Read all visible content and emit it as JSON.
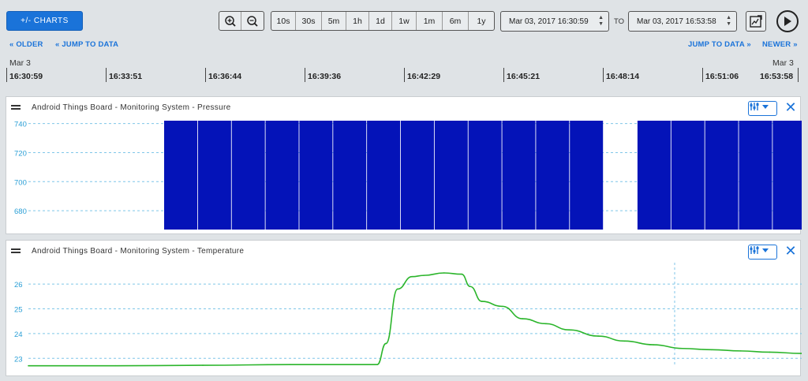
{
  "toolbar": {
    "charts_label": "+/- CHARTS",
    "zoom_ranges": [
      "10s",
      "30s",
      "5m",
      "1h",
      "1d",
      "1w",
      "1m",
      "6m",
      "1y"
    ],
    "from": "Mar 03, 2017 16:30:59",
    "to_label": "TO",
    "to": "Mar 03, 2017 16:53:58"
  },
  "nav": {
    "older": "« OLDER",
    "jump_left": "« JUMP TO DATA",
    "jump_right": "JUMP TO DATA »",
    "newer": "NEWER »"
  },
  "time_axis": {
    "start_date": "Mar 3",
    "end_date": "Mar 3",
    "ticks": [
      "16:30:59",
      "16:33:51",
      "16:36:44",
      "16:39:36",
      "16:42:29",
      "16:45:21",
      "16:48:14",
      "16:51:06",
      "16:53:58"
    ]
  },
  "panels": [
    {
      "title": "Android Things Board - Monitoring System - Pressure"
    },
    {
      "title": "Android Things Board - Monitoring System - Temperature"
    }
  ],
  "chart_data": [
    {
      "type": "bar",
      "title": "Android Things Board - Monitoring System - Pressure",
      "y_ticks": [
        680,
        700,
        720,
        740
      ],
      "ylim": [
        667,
        742
      ],
      "bar_top": 742,
      "x": [
        "16:35",
        "16:35:45",
        "16:36:30",
        "16:37:15",
        "16:38",
        "16:38:45",
        "16:39:30",
        "16:40:15",
        "16:41",
        "16:41:45",
        "16:42:30",
        "16:43:15",
        "16:44",
        "16:45:45",
        "16:46:30",
        "16:47:15",
        "16:48",
        "16:48:45",
        "16:49:30"
      ],
      "values": [
        742,
        742,
        742,
        742,
        742,
        742,
        742,
        742,
        742,
        742,
        742,
        742,
        742,
        742,
        742,
        742,
        742,
        742,
        742
      ],
      "color": "#0413b8"
    },
    {
      "type": "line",
      "title": "Android Things Board - Monitoring System - Temperature",
      "y_ticks": [
        23,
        24,
        25,
        26
      ],
      "ylim": [
        22.5,
        26.8
      ],
      "x": [
        0,
        3,
        6,
        9,
        12,
        12.3,
        12.7,
        13.2,
        13.6,
        14.3,
        14.9,
        15.2,
        15.6,
        16.3,
        17.0,
        17.8,
        18.6,
        19.6,
        20.5,
        21.5,
        22.5,
        23.5,
        24.5,
        25.5,
        26.6
      ],
      "values": [
        22.7,
        22.7,
        22.72,
        22.75,
        22.75,
        23.6,
        25.8,
        26.3,
        26.35,
        26.45,
        26.4,
        25.9,
        25.3,
        25.1,
        24.6,
        24.4,
        24.15,
        23.9,
        23.7,
        23.55,
        23.4,
        23.35,
        23.3,
        23.25,
        23.2
      ],
      "color": "#2bb52b"
    }
  ]
}
